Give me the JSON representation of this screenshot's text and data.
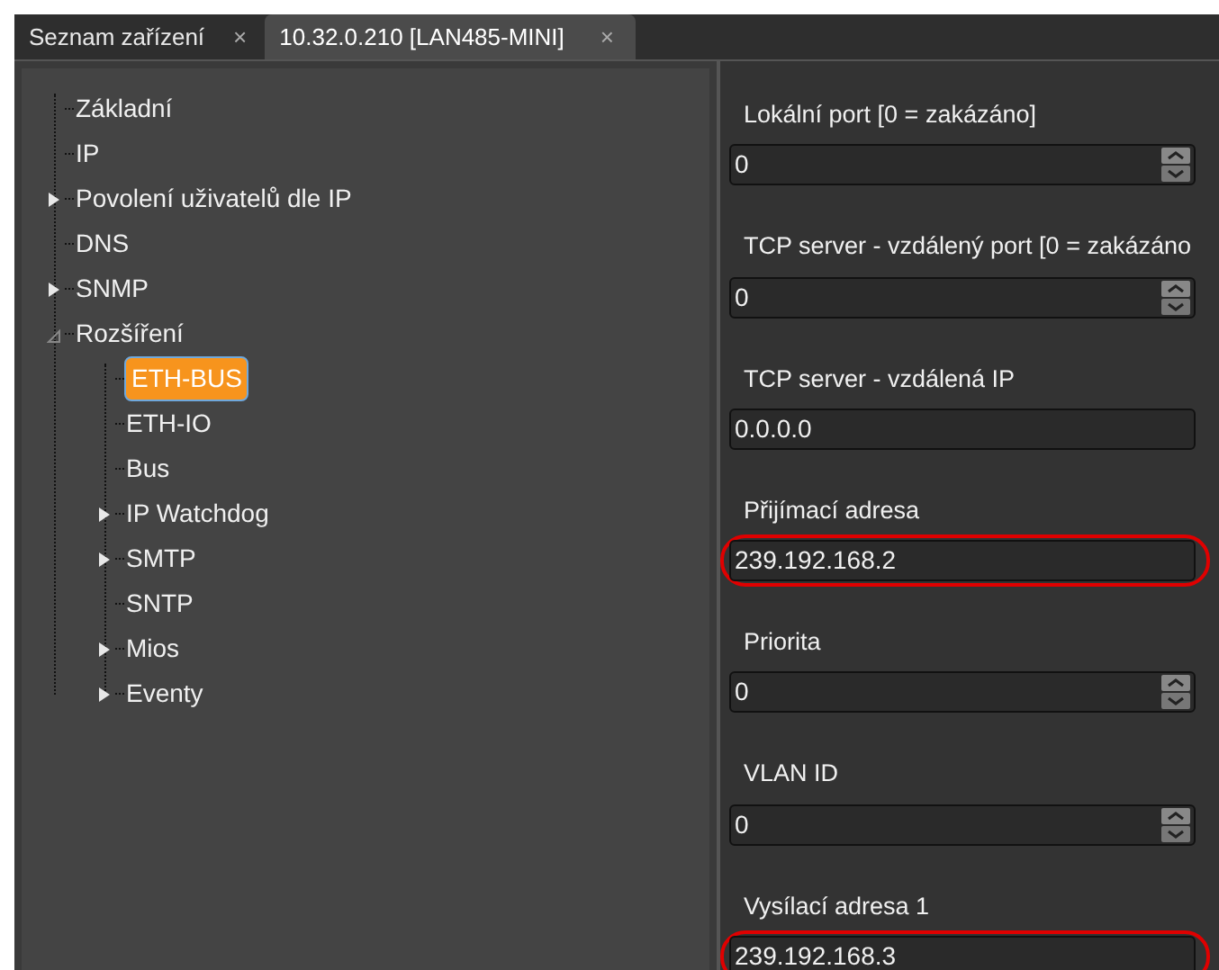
{
  "tabs": [
    {
      "label": "Seznam zařízení",
      "close": "×",
      "selected": false
    },
    {
      "label": "10.32.0.210 [LAN485-MINI]",
      "close": "×",
      "selected": true
    }
  ],
  "tree": [
    {
      "label": "Základní",
      "selected": false
    },
    {
      "label": "IP",
      "selected": false
    },
    {
      "label": "Povolení uživatelů dle IP",
      "selected": false,
      "expanded": false
    },
    {
      "label": "DNS",
      "selected": false
    },
    {
      "label": "SNMP",
      "selected": false,
      "expanded": false
    },
    {
      "label": "Rozšíření",
      "selected": false,
      "expanded": true,
      "children": [
        {
          "label": "ETH-BUS",
          "selected": true
        },
        {
          "label": "ETH-IO",
          "selected": false
        },
        {
          "label": "Bus",
          "selected": false
        },
        {
          "label": "IP Watchdog",
          "selected": false,
          "expanded": false
        },
        {
          "label": "SMTP",
          "selected": false,
          "expanded": false
        },
        {
          "label": "SNTP",
          "selected": false
        },
        {
          "label": "Mios",
          "selected": false,
          "expanded": false
        },
        {
          "label": "Eventy",
          "selected": false,
          "expanded": false
        }
      ]
    }
  ],
  "fields": [
    {
      "label": "Lokální port [0 = zakázáno]",
      "kind": "spin",
      "value": "0",
      "highlighted": false
    },
    {
      "label": "TCP server - vzdálený port [0 = zakázáno",
      "kind": "spin",
      "value": "0",
      "highlighted": false
    },
    {
      "label": "TCP server - vzdálená IP",
      "kind": "text",
      "value": "0.0.0.0",
      "highlighted": false
    },
    {
      "label": "Přijímací adresa",
      "kind": "text",
      "value": "239.192.168.2",
      "highlighted": true
    },
    {
      "label": "Priorita",
      "kind": "spin",
      "value": "0",
      "highlighted": false
    },
    {
      "label": "VLAN ID",
      "kind": "spin",
      "value": "0",
      "highlighted": false
    },
    {
      "label": "Vysílací adresa 1",
      "kind": "text",
      "value": "239.192.168.3",
      "highlighted": true
    }
  ]
}
